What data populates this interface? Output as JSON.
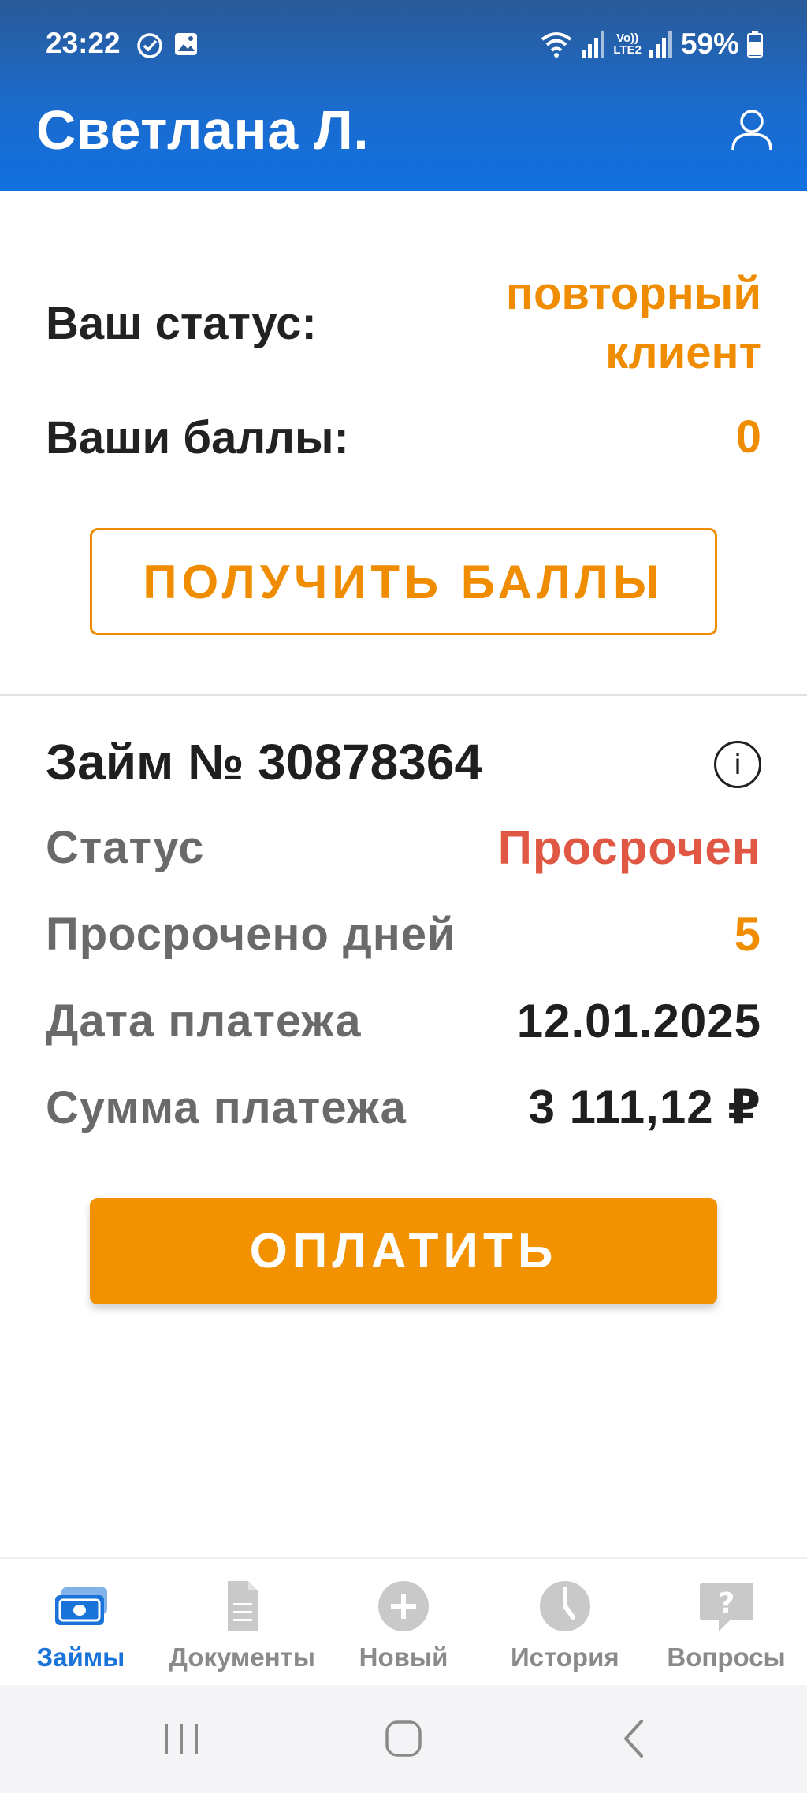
{
  "status_bar": {
    "time": "23:22",
    "battery": "59%",
    "network": "LTE2",
    "volte": "Vo))",
    "icons": [
      "check-circle-icon",
      "image-icon",
      "wifi-icon",
      "signal-icon",
      "battery-icon"
    ]
  },
  "header": {
    "title": "Светлана Л.",
    "profile_icon": "user-icon"
  },
  "client": {
    "status_label": "Ваш статус:",
    "status_value_line1": "повторный",
    "status_value_line2": "клиент",
    "points_label": "Ваши баллы:",
    "points_value": "0",
    "get_points_button": "ПОЛУЧИТЬ БАЛЛЫ"
  },
  "loan": {
    "title": "Займ № 30878364",
    "info_icon_text": "i",
    "status_label": "Статус",
    "status_value": "Просрочен",
    "overdue_label": "Просрочено дней",
    "overdue_value": "5",
    "date_label": "Дата платежа",
    "date_value": "12.01.2025",
    "amount_label": "Сумма платежа",
    "amount_value": "3 111,12 ₽",
    "pay_button": "ОПЛАТИТЬ"
  },
  "bottom_nav": {
    "items": [
      {
        "label": "Займы",
        "icon": "money-icon",
        "active": true
      },
      {
        "label": "Документы",
        "icon": "document-icon",
        "active": false
      },
      {
        "label": "Новый",
        "icon": "plus-circle-icon",
        "active": false
      },
      {
        "label": "История",
        "icon": "clock-icon",
        "active": false
      },
      {
        "label": "Вопросы",
        "icon": "question-bubble-icon",
        "active": false
      }
    ]
  },
  "colors": {
    "header_blue": "#1b6bcc",
    "accent_orange": "#f08c00",
    "overdue_red": "#e05843",
    "active_nav_blue": "#1a73d9"
  }
}
